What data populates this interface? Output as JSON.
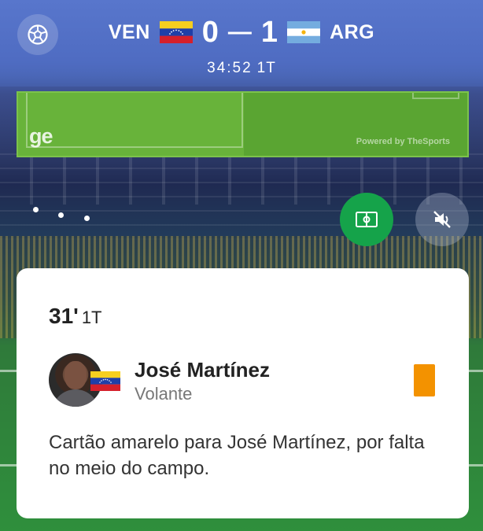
{
  "header": {
    "home_team": "VEN",
    "away_team": "ARG",
    "home_score": "0",
    "separator": "—",
    "away_score": "1",
    "clock": "34:52",
    "period": "1T",
    "icons": {
      "menu": "soccer-ball-icon"
    }
  },
  "banner": {
    "logo": "ge",
    "powered_by": "Powered by TheSports"
  },
  "controls": {
    "pitch_view": "pitch-view-icon",
    "mute": "speaker-muted-icon"
  },
  "event": {
    "minute": "31'",
    "period": "1T",
    "player_name": "José Martínez",
    "player_role": "Volante",
    "card_type": "yellow",
    "description": "Cartão amarelo para José Martínez, por falta no meio do campo."
  },
  "colors": {
    "header_blue": "#5876cc",
    "banner_green": "#68b33a",
    "pitch_button_green": "#15a34a",
    "yellow_card": "#f39200"
  }
}
